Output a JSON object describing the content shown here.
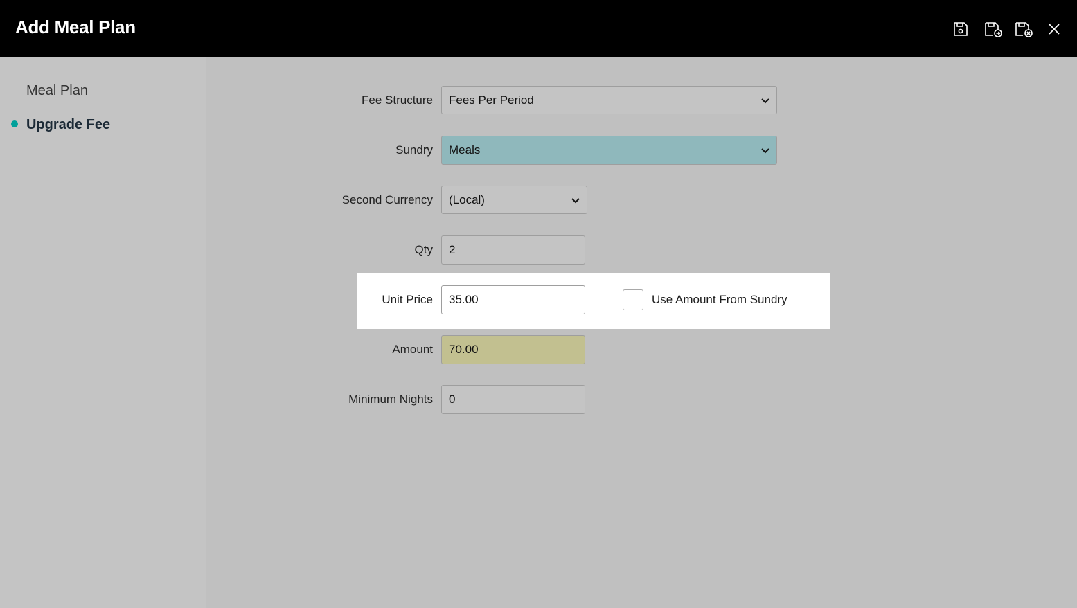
{
  "header": {
    "title": "Add Meal Plan",
    "tools": [
      "save-icon",
      "save-and-new-icon",
      "save-and-close-icon",
      "close-icon"
    ]
  },
  "sidebar": {
    "items": [
      {
        "label": "Meal Plan",
        "active": false
      },
      {
        "label": "Upgrade Fee",
        "active": true
      }
    ],
    "active_dot_color": "#00a09a"
  },
  "form": {
    "fee_structure": {
      "label": "Fee Structure",
      "value": "Fees Per Period"
    },
    "sundry": {
      "label": "Sundry",
      "value": "Meals",
      "color": "#8fb8bc"
    },
    "second_currency": {
      "label": "Second Currency",
      "value": "(Local)"
    },
    "qty": {
      "label": "Qty",
      "value": "2"
    },
    "unit_price": {
      "label": "Unit Price",
      "value": "35.00"
    },
    "use_amount_from_sundry": {
      "label": "Use Amount From Sundry",
      "checked": false
    },
    "amount": {
      "label": "Amount",
      "value": "70.00",
      "color": "#c2c090"
    },
    "minimum_nights": {
      "label": "Minimum Nights",
      "value": "0"
    }
  }
}
